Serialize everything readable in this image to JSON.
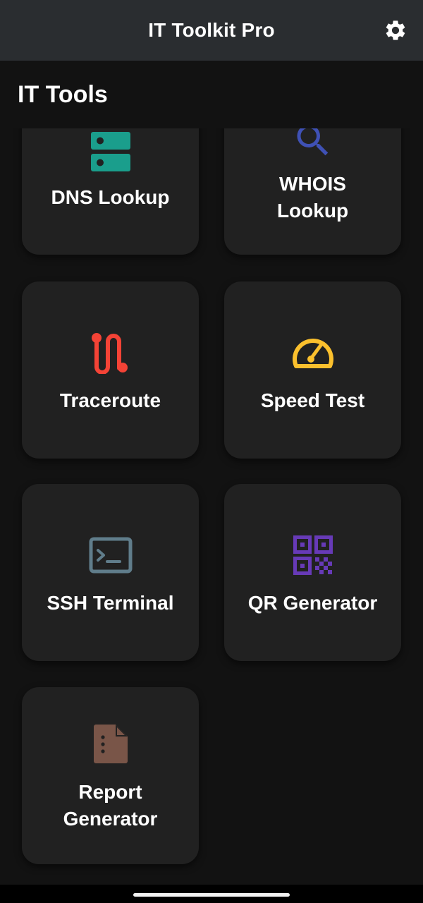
{
  "app_bar": {
    "title": "IT Toolkit Pro",
    "settings_icon": "gear-icon"
  },
  "section": {
    "title": "IT Tools"
  },
  "tools": [
    {
      "label": "DNS Lookup",
      "icon": "dns-server-icon",
      "color": "#1a9e8c"
    },
    {
      "label": "WHOIS\nLookup",
      "icon": "search-icon",
      "color": "#3f51b5"
    },
    {
      "label": "Traceroute",
      "icon": "route-icon",
      "color": "#f44336"
    },
    {
      "label": "Speed Test",
      "icon": "speedometer-icon",
      "color": "#fbc02d"
    },
    {
      "label": "SSH Terminal",
      "icon": "terminal-icon",
      "color": "#607d8b"
    },
    {
      "label": "QR Generator",
      "icon": "qr-code-icon",
      "color": "#673ab7"
    },
    {
      "label": "Report\nGenerator",
      "icon": "document-icon",
      "color": "#795548"
    }
  ]
}
